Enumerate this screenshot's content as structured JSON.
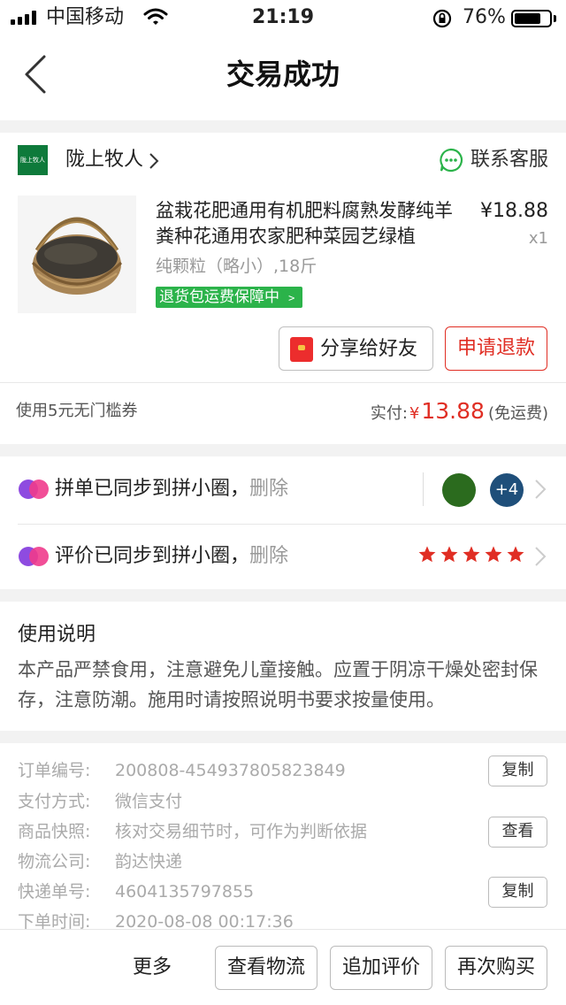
{
  "status_bar": {
    "carrier": "中国移动",
    "time": "21:19",
    "battery_percent_label": "76%",
    "battery_level": 0.76
  },
  "nav": {
    "title": "交易成功",
    "back_icon": "chevron-left-icon"
  },
  "shop": {
    "logo_text": "陇上牧人",
    "name": "陇上牧人",
    "contact_label": "联系客服",
    "contact_icon": "chat-bubble-icon",
    "accent_green": "#2bb34a"
  },
  "product": {
    "title": "盆栽花肥通用有机肥料腐熟发酵纯羊粪种花通用农家肥种菜园艺绿植",
    "price": "¥18.88",
    "quantity": "x1",
    "spec": "纯颗粒（略小）,18斤",
    "guarantee_label": "退货包运费保障中",
    "share_label": "分享给好友",
    "refund_label": "申请退款"
  },
  "payment": {
    "coupon_text": "使用5元无门槛券",
    "paid_label": "实付:",
    "currency": "¥",
    "paid_amount": "13.88",
    "shipping_note": "(免运费)",
    "accent_red": "#e02e24"
  },
  "sync": {
    "group_text": "拼单已同步到拼小圈，",
    "review_text": "评价已同步到拼小圈，",
    "delete_label": "删除",
    "more_avatars_label": "+4",
    "rating_stars": 5
  },
  "usage": {
    "title": "使用说明",
    "body": "本产品严禁食用，注意避免儿童接触。应置于阴凉干燥处密封保存，注意防潮。施用时请按照说明书要求按量使用。"
  },
  "order_info": {
    "rows": [
      {
        "label": "订单编号:",
        "value": "200808-454937805823849",
        "action": "复制"
      },
      {
        "label": "支付方式:",
        "value": "微信支付"
      },
      {
        "label": "商品快照:",
        "value": "核对交易细节时，可作为判断依据",
        "action": "查看"
      },
      {
        "label": "物流公司:",
        "value": "韵达快递"
      },
      {
        "label": "快递单号:",
        "value": "4604135797855",
        "action": "复制"
      },
      {
        "label": "下单时间:",
        "value": "2020-08-08 00:17:36"
      }
    ]
  },
  "bottom_bar": {
    "more_label": "更多",
    "logistics_label": "查看物流",
    "add_review_label": "追加评价",
    "buy_again_label": "再次购买"
  }
}
